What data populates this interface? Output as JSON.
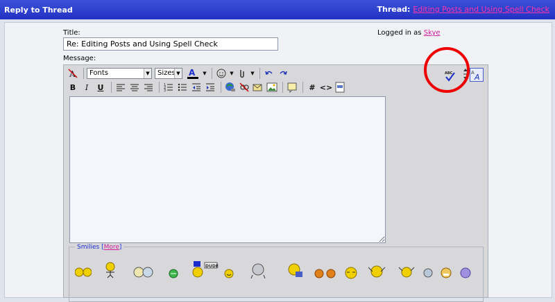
{
  "titlebar": {
    "title": "Reply to Thread",
    "thread_label": "Thread:",
    "thread_name": "Editing Posts and Using Spell Check"
  },
  "form": {
    "title_label": "Title:",
    "title_value": "Re: Editing Posts and Using Spell Check",
    "logged_in_label": "Logged in as",
    "username": "Skye",
    "message_label": "Message:"
  },
  "toolbar": {
    "font_select": "Fonts",
    "size_select": "Sizes",
    "bold": "B",
    "italic": "I",
    "underline": "U",
    "code_tag": "#",
    "html_tag": "<>"
  },
  "smilies": {
    "legend_label": "Smilies",
    "more_link": "More",
    "badge_text": "DUDE"
  },
  "colors": {
    "titlebar_bg": "#2a3ad0",
    "link": "#cc1d9d",
    "annotation": "#ee0000"
  }
}
